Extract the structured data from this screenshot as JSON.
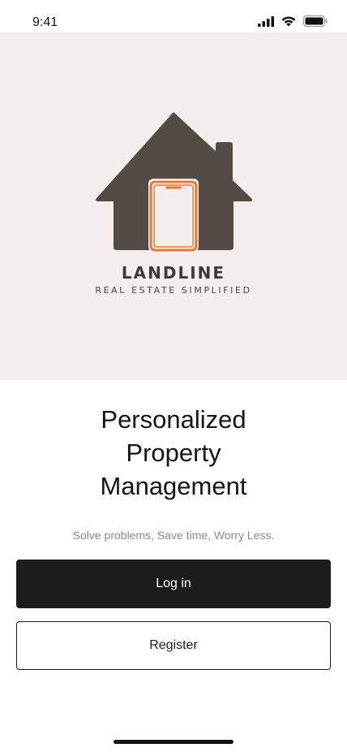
{
  "status_bar": {
    "time": "9:41",
    "icons": [
      "cellular-signal-icon",
      "wifi-icon",
      "battery-icon"
    ]
  },
  "brand": {
    "name": "LANDLINE",
    "tagline": "REAL ESTATE SIMPLIFIED",
    "colors": {
      "house": "#524b46",
      "phone_accent": "#e8782e",
      "hero_background": "#f4efec"
    }
  },
  "headline": "Personalized\nProperty\nManagement",
  "subtitle": "Solve problems, Save time, Worry Less.",
  "actions": {
    "login_label": "Log in",
    "register_label": "Register"
  },
  "theme": {
    "primary_button": "#1b1c1b",
    "secondary_border": "#1b1b1b"
  }
}
